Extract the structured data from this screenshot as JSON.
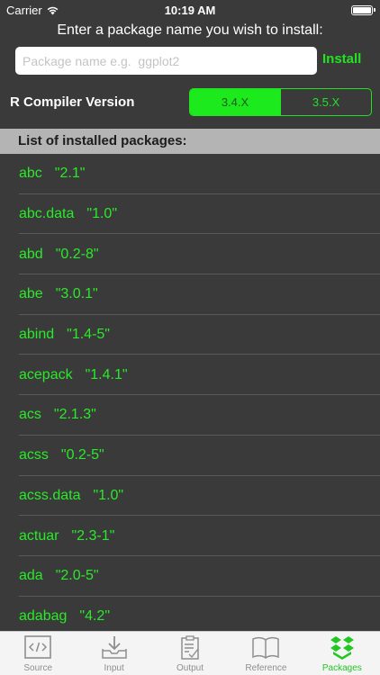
{
  "status_bar": {
    "carrier": "Carrier",
    "time": "10:19 AM"
  },
  "install_panel": {
    "prompt": "Enter a package name you wish to install:",
    "input_value": "",
    "input_placeholder": "Package name e.g.  ggplot2",
    "install_label": "Install"
  },
  "compiler": {
    "label": "R Compiler Version",
    "options": [
      "3.4.X",
      "3.5.X"
    ],
    "selected": "3.4.X"
  },
  "packages": {
    "header": "List of installed packages:",
    "items": [
      {
        "name": "abc",
        "version": "\"2.1\""
      },
      {
        "name": "abc.data",
        "version": "\"1.0\""
      },
      {
        "name": "abd",
        "version": "\"0.2-8\""
      },
      {
        "name": "abe",
        "version": "\"3.0.1\""
      },
      {
        "name": "abind",
        "version": "\"1.4-5\""
      },
      {
        "name": "acepack",
        "version": "\"1.4.1\""
      },
      {
        "name": "acs",
        "version": "\"2.1.3\""
      },
      {
        "name": "acss",
        "version": "\"0.2-5\""
      },
      {
        "name": "acss.data",
        "version": "\"1.0\""
      },
      {
        "name": "actuar",
        "version": "\"2.3-1\""
      },
      {
        "name": "ada",
        "version": "\"2.0-5\""
      },
      {
        "name": "adabag",
        "version": "\"4.2\""
      }
    ]
  },
  "tab_bar": {
    "tabs": [
      {
        "label": "Source",
        "icon": "code-icon"
      },
      {
        "label": "Input",
        "icon": "download-tray-icon"
      },
      {
        "label": "Output",
        "icon": "clipboard-check-icon"
      },
      {
        "label": "Reference",
        "icon": "open-book-icon"
      },
      {
        "label": "Packages",
        "icon": "boxes-icon"
      }
    ],
    "active": "Packages"
  },
  "colors": {
    "accent_green": "#22e222",
    "background": "#3a3a3a",
    "list_header_bg": "#b4b4b4",
    "tab_inactive": "#8e8e8e"
  }
}
